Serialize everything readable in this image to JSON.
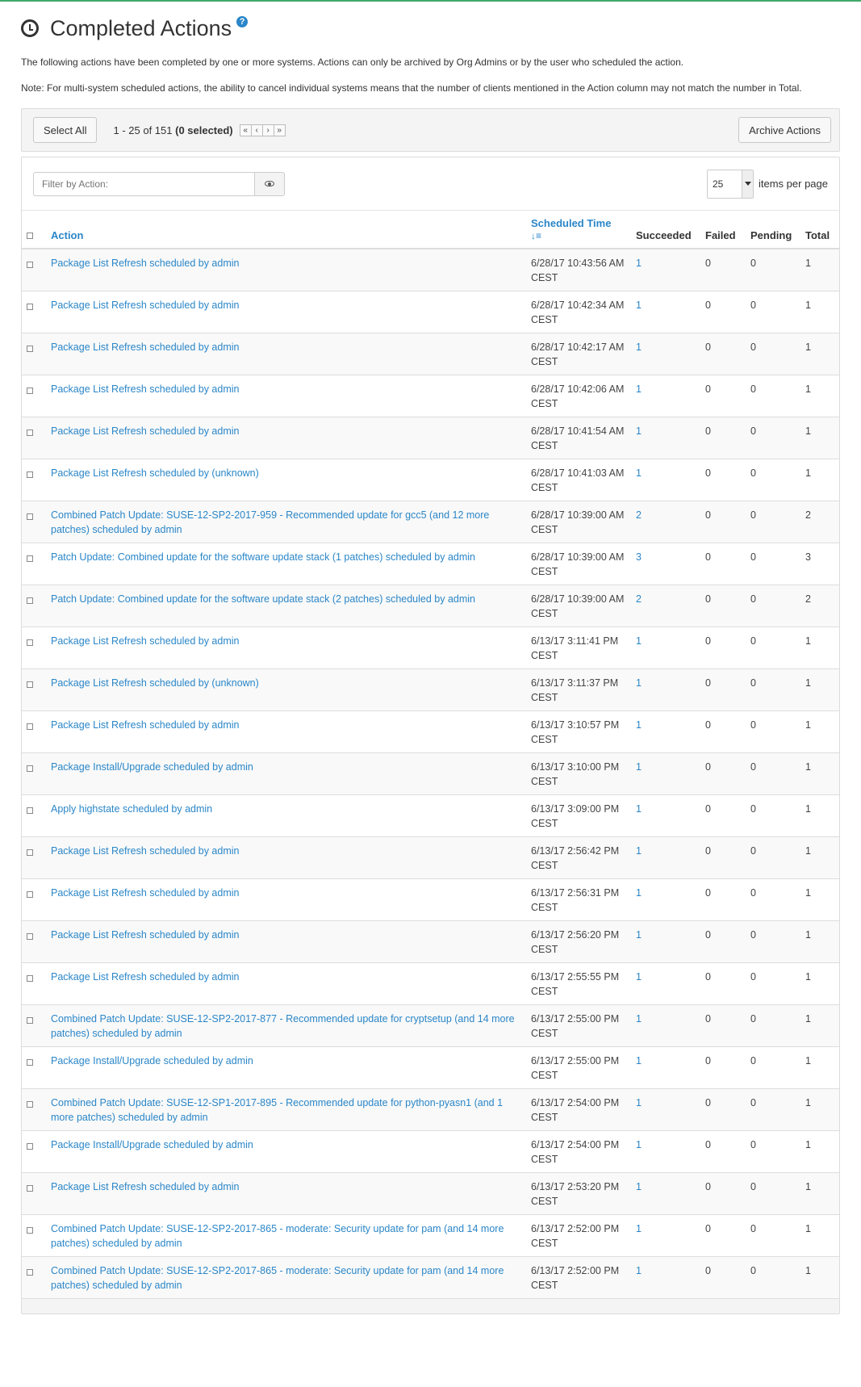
{
  "header": {
    "title": "Completed Actions",
    "help": "?",
    "description": "The following actions have been completed by one or more systems. Actions can only be archived by Org Admins or by the user who scheduled the action.",
    "note": "Note: For multi-system scheduled actions, the ability to cancel individual systems means that the number of clients mentioned in the Action column may not match the number in Total."
  },
  "toolbar": {
    "select_all": "Select All",
    "range": "1 - 25 of 151",
    "selected": "(0 selected)",
    "pager": [
      "«",
      "‹",
      "›",
      "»"
    ],
    "archive": "Archive Actions"
  },
  "filter": {
    "placeholder": "Filter by Action:",
    "per_page_value": "25",
    "per_page_label": "items per page"
  },
  "columns": {
    "action": "Action",
    "scheduled_time": "Scheduled Time",
    "succeeded": "Succeeded",
    "failed": "Failed",
    "pending": "Pending",
    "total": "Total"
  },
  "rows": [
    {
      "action": "Package List Refresh scheduled by admin",
      "time": "6/28/17 10:43:56 AM CEST",
      "succeeded": "1",
      "failed": "0",
      "pending": "0",
      "total": "1"
    },
    {
      "action": "Package List Refresh scheduled by admin",
      "time": "6/28/17 10:42:34 AM CEST",
      "succeeded": "1",
      "failed": "0",
      "pending": "0",
      "total": "1"
    },
    {
      "action": "Package List Refresh scheduled by admin",
      "time": "6/28/17 10:42:17 AM CEST",
      "succeeded": "1",
      "failed": "0",
      "pending": "0",
      "total": "1"
    },
    {
      "action": "Package List Refresh scheduled by admin",
      "time": "6/28/17 10:42:06 AM CEST",
      "succeeded": "1",
      "failed": "0",
      "pending": "0",
      "total": "1"
    },
    {
      "action": "Package List Refresh scheduled by admin",
      "time": "6/28/17 10:41:54 AM CEST",
      "succeeded": "1",
      "failed": "0",
      "pending": "0",
      "total": "1"
    },
    {
      "action": "Package List Refresh scheduled by (unknown)",
      "time": "6/28/17 10:41:03 AM CEST",
      "succeeded": "1",
      "failed": "0",
      "pending": "0",
      "total": "1"
    },
    {
      "action": "Combined Patch Update: SUSE-12-SP2-2017-959 - Recommended update for gcc5 (and 12 more patches) scheduled by admin",
      "time": "6/28/17 10:39:00 AM CEST",
      "succeeded": "2",
      "failed": "0",
      "pending": "0",
      "total": "2"
    },
    {
      "action": "Patch Update: Combined update for the software update stack (1 patches) scheduled by admin",
      "time": "6/28/17 10:39:00 AM CEST",
      "succeeded": "3",
      "failed": "0",
      "pending": "0",
      "total": "3"
    },
    {
      "action": "Patch Update: Combined update for the software update stack (2 patches) scheduled by admin",
      "time": "6/28/17 10:39:00 AM CEST",
      "succeeded": "2",
      "failed": "0",
      "pending": "0",
      "total": "2"
    },
    {
      "action": "Package List Refresh scheduled by admin",
      "time": "6/13/17 3:11:41 PM CEST",
      "succeeded": "1",
      "failed": "0",
      "pending": "0",
      "total": "1"
    },
    {
      "action": "Package List Refresh scheduled by (unknown)",
      "time": "6/13/17 3:11:37 PM CEST",
      "succeeded": "1",
      "failed": "0",
      "pending": "0",
      "total": "1"
    },
    {
      "action": "Package List Refresh scheduled by admin",
      "time": "6/13/17 3:10:57 PM CEST",
      "succeeded": "1",
      "failed": "0",
      "pending": "0",
      "total": "1"
    },
    {
      "action": "Package Install/Upgrade scheduled by admin",
      "time": "6/13/17 3:10:00 PM CEST",
      "succeeded": "1",
      "failed": "0",
      "pending": "0",
      "total": "1"
    },
    {
      "action": "Apply highstate scheduled by admin",
      "time": "6/13/17 3:09:00 PM CEST",
      "succeeded": "1",
      "failed": "0",
      "pending": "0",
      "total": "1"
    },
    {
      "action": "Package List Refresh scheduled by admin",
      "time": "6/13/17 2:56:42 PM CEST",
      "succeeded": "1",
      "failed": "0",
      "pending": "0",
      "total": "1"
    },
    {
      "action": "Package List Refresh scheduled by admin",
      "time": "6/13/17 2:56:31 PM CEST",
      "succeeded": "1",
      "failed": "0",
      "pending": "0",
      "total": "1"
    },
    {
      "action": "Package List Refresh scheduled by admin",
      "time": "6/13/17 2:56:20 PM CEST",
      "succeeded": "1",
      "failed": "0",
      "pending": "0",
      "total": "1"
    },
    {
      "action": "Package List Refresh scheduled by admin",
      "time": "6/13/17 2:55:55 PM CEST",
      "succeeded": "1",
      "failed": "0",
      "pending": "0",
      "total": "1"
    },
    {
      "action": "Combined Patch Update: SUSE-12-SP2-2017-877 - Recommended update for cryptsetup (and 14 more patches) scheduled by admin",
      "time": "6/13/17 2:55:00 PM CEST",
      "succeeded": "1",
      "failed": "0",
      "pending": "0",
      "total": "1"
    },
    {
      "action": "Package Install/Upgrade scheduled by admin",
      "time": "6/13/17 2:55:00 PM CEST",
      "succeeded": "1",
      "failed": "0",
      "pending": "0",
      "total": "1"
    },
    {
      "action": "Combined Patch Update: SUSE-12-SP1-2017-895 - Recommended update for python-pyasn1 (and 1 more patches) scheduled by admin",
      "time": "6/13/17 2:54:00 PM CEST",
      "succeeded": "1",
      "failed": "0",
      "pending": "0",
      "total": "1"
    },
    {
      "action": "Package Install/Upgrade scheduled by admin",
      "time": "6/13/17 2:54:00 PM CEST",
      "succeeded": "1",
      "failed": "0",
      "pending": "0",
      "total": "1"
    },
    {
      "action": "Package List Refresh scheduled by admin",
      "time": "6/13/17 2:53:20 PM CEST",
      "succeeded": "1",
      "failed": "0",
      "pending": "0",
      "total": "1"
    },
    {
      "action": "Combined Patch Update: SUSE-12-SP2-2017-865 - moderate: Security update for pam (and 14 more patches) scheduled by admin",
      "time": "6/13/17 2:52:00 PM CEST",
      "succeeded": "1",
      "failed": "0",
      "pending": "0",
      "total": "1"
    },
    {
      "action": "Combined Patch Update: SUSE-12-SP2-2017-865 - moderate: Security update for pam (and 14 more patches) scheduled by admin",
      "time": "6/13/17 2:52:00 PM CEST",
      "succeeded": "1",
      "failed": "0",
      "pending": "0",
      "total": "1"
    }
  ]
}
